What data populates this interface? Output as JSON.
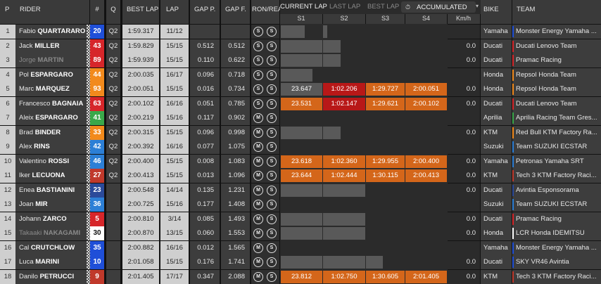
{
  "columns": {
    "pos": "P",
    "rider": "RIDER",
    "num": "#",
    "q": "Q",
    "best": "BEST LAP",
    "lap": "LAP",
    "gap_p": "GAP P.",
    "gap_f": "GAP F.",
    "tyres": "RON/REAR",
    "s1": "S1",
    "s2": "S2",
    "s3": "S3",
    "s4": "S4",
    "kmh": "Km/h",
    "bike": "BIKE",
    "team": "TEAM"
  },
  "tabs": {
    "current": "CURRENT LAP",
    "last": "LAST LAP",
    "best": "BEST LAP",
    "accumulated": "ACCUMULATED",
    "acc_icon": "stopwatch-icon",
    "chevron": "chevron-down-icon"
  },
  "colors": {
    "sector_orange": "#d4661a",
    "sector_red": "#b81818",
    "sector_grey": "#595959",
    "row_bg": "#3d3d3d",
    "light_cell": "#cfcfcf"
  },
  "rows": [
    {
      "pos": "1",
      "first": "Fabio",
      "last": "QUARTARARO",
      "num": "20",
      "num_color": "#1f4fd8",
      "q": "Q2",
      "best": "1:59.317",
      "lap": "11/12",
      "gap_p": "",
      "gap_f": "",
      "front": "S",
      "rear": "S",
      "s1": "",
      "s2": "",
      "s3": "",
      "s4": "",
      "s1_fill": 0.58,
      "s2_fill": 0.1,
      "s3_fill": 0,
      "s4_fill": 0,
      "sec_colors": [
        "",
        "",
        "",
        ""
      ],
      "kmh": "",
      "bike": "Yamaha",
      "team": "Monster Energy Yamaha ...",
      "team_color": "#1f4fd8",
      "dim": false
    },
    {
      "pos": "2",
      "first": "Jack",
      "last": "MILLER",
      "num": "43",
      "num_color": "#d6262a",
      "q": "Q2",
      "best": "1:59.829",
      "lap": "15/15",
      "gap_p": "0.512",
      "gap_f": "0.512",
      "front": "S",
      "rear": "S",
      "s1": "",
      "s2": "",
      "s3": "",
      "s4": "",
      "s1_fill": 1,
      "s2_fill": 0.42,
      "s3_fill": 0,
      "s4_fill": 0,
      "sec_colors": [
        "",
        "",
        "",
        ""
      ],
      "kmh": "0.0",
      "bike": "Ducati",
      "team": "Ducati Lenovo Team",
      "team_color": "#d6262a",
      "dim": false
    },
    {
      "pos": "3",
      "first": "Jorge",
      "last": "MARTIN",
      "num": "89",
      "num_color": "#d6262a",
      "q": "Q2",
      "best": "1:59.939",
      "lap": "15/15",
      "gap_p": "0.110",
      "gap_f": "0.622",
      "front": "S",
      "rear": "S",
      "s1": "",
      "s2": "",
      "s3": "",
      "s4": "",
      "s1_fill": 1,
      "s2_fill": 0.42,
      "s3_fill": 0,
      "s4_fill": 0,
      "sec_colors": [
        "",
        "",
        "",
        ""
      ],
      "kmh": "0.0",
      "bike": "Ducati",
      "team": "Pramac Racing",
      "team_color": "#d6262a",
      "dim": true
    },
    {
      "pos": "4",
      "first": "Pol",
      "last": "ESPARGARO",
      "num": "44",
      "num_color": "#f28a1c",
      "q": "Q2",
      "best": "2:00.035",
      "lap": "16/17",
      "gap_p": "0.096",
      "gap_f": "0.718",
      "front": "S",
      "rear": "S",
      "s1": "",
      "s2": "",
      "s3": "",
      "s4": "",
      "s1_fill": 0.77,
      "s2_fill": 0,
      "s3_fill": 0,
      "s4_fill": 0,
      "sec_colors": [
        "",
        "",
        "",
        ""
      ],
      "kmh": "",
      "bike": "Honda",
      "team": "Repsol Honda Team",
      "team_color": "#f28a1c",
      "dim": false
    },
    {
      "pos": "5",
      "first": "Marc",
      "last": "MARQUEZ",
      "num": "93",
      "num_color": "#f28a1c",
      "q": "Q2",
      "best": "2:00.051",
      "lap": "15/15",
      "gap_p": "0.016",
      "gap_f": "0.734",
      "front": "S",
      "rear": "S",
      "s1": "23.647",
      "s2": "1:02.206",
      "s3": "1:29.727",
      "s4": "2:00.051",
      "s1_fill": 1,
      "s2_fill": 1,
      "s3_fill": 1,
      "s4_fill": 1,
      "sec_colors": [
        "#595959",
        "#b81818",
        "#d4661a",
        "#d4661a"
      ],
      "kmh": "0.0",
      "bike": "Honda",
      "team": "Repsol Honda Team",
      "team_color": "#f28a1c",
      "dim": false
    },
    {
      "pos": "6",
      "first": "Francesco",
      "last": "BAGNAIA",
      "num": "63",
      "num_color": "#d6262a",
      "q": "Q2",
      "best": "2:00.102",
      "lap": "16/16",
      "gap_p": "0.051",
      "gap_f": "0.785",
      "front": "S",
      "rear": "S",
      "s1": "23.531",
      "s2": "1:02.147",
      "s3": "1:29.621",
      "s4": "2:00.102",
      "s1_fill": 1,
      "s2_fill": 1,
      "s3_fill": 1,
      "s4_fill": 1,
      "sec_colors": [
        "#d4661a",
        "#b81818",
        "#d4661a",
        "#d4661a"
      ],
      "kmh": "0.0",
      "bike": "Ducati",
      "team": "Ducati Lenovo Team",
      "team_color": "#d6262a",
      "dim": false
    },
    {
      "pos": "7",
      "first": "Aleix",
      "last": "ESPARGARO",
      "num": "41",
      "num_color": "#3aa84a",
      "q": "Q2",
      "best": "2:00.219",
      "lap": "15/16",
      "gap_p": "0.117",
      "gap_f": "0.902",
      "front": "M",
      "rear": "S",
      "s1": "",
      "s2": "",
      "s3": "",
      "s4": "",
      "s1_fill": 0,
      "s2_fill": 0,
      "s3_fill": 0,
      "s4_fill": 0,
      "sec_colors": [
        "",
        "",
        "",
        ""
      ],
      "kmh": "",
      "bike": "Aprilia",
      "team": "Aprilia Racing Team Gres...",
      "team_color": "#3aa84a",
      "dim": false
    },
    {
      "pos": "8",
      "first": "Brad",
      "last": "BINDER",
      "num": "33",
      "num_color": "#f28a1c",
      "q": "Q2",
      "best": "2:00.315",
      "lap": "15/15",
      "gap_p": "0.096",
      "gap_f": "0.998",
      "front": "M",
      "rear": "S",
      "s1": "",
      "s2": "",
      "s3": "",
      "s4": "",
      "s1_fill": 1,
      "s2_fill": 0.42,
      "s3_fill": 0,
      "s4_fill": 0,
      "sec_colors": [
        "",
        "",
        "",
        ""
      ],
      "kmh": "0.0",
      "bike": "KTM",
      "team": "Red Bull KTM Factory Ra...",
      "team_color": "#f28a1c",
      "dim": false
    },
    {
      "pos": "9",
      "first": "Alex",
      "last": "RINS",
      "num": "42",
      "num_color": "#2c7fd6",
      "q": "Q2",
      "best": "2:00.392",
      "lap": "16/16",
      "gap_p": "0.077",
      "gap_f": "1.075",
      "front": "M",
      "rear": "S",
      "s1": "",
      "s2": "",
      "s3": "",
      "s4": "",
      "s1_fill": 0,
      "s2_fill": 0,
      "s3_fill": 0,
      "s4_fill": 0,
      "sec_colors": [
        "",
        "",
        "",
        ""
      ],
      "kmh": "",
      "bike": "Suzuki",
      "team": "Team SUZUKI ECSTAR",
      "team_color": "#2c7fd6",
      "dim": false
    },
    {
      "pos": "10",
      "first": "Valentino",
      "last": "ROSSI",
      "num": "46",
      "num_color": "#2c7fd6",
      "q": "Q2",
      "best": "2:00.400",
      "lap": "15/15",
      "gap_p": "0.008",
      "gap_f": "1.083",
      "front": "M",
      "rear": "S",
      "s1": "23.618",
      "s2": "1:02.360",
      "s3": "1:29.955",
      "s4": "2:00.400",
      "s1_fill": 1,
      "s2_fill": 1,
      "s3_fill": 1,
      "s4_fill": 1,
      "sec_colors": [
        "#d4661a",
        "#d4661a",
        "#d4661a",
        "#d4661a"
      ],
      "kmh": "0.0",
      "bike": "Yamaha",
      "team": "Petronas Yamaha SRT",
      "team_color": "#2c7fd6",
      "dim": false
    },
    {
      "pos": "11",
      "first": "Iker",
      "last": "LECUONA",
      "num": "27",
      "num_color": "#c0392b",
      "q": "Q2",
      "best": "2:00.413",
      "lap": "15/15",
      "gap_p": "0.013",
      "gap_f": "1.096",
      "front": "M",
      "rear": "S",
      "s1": "23.644",
      "s2": "1:02.444",
      "s3": "1:30.115",
      "s4": "2:00.413",
      "s1_fill": 1,
      "s2_fill": 1,
      "s3_fill": 1,
      "s4_fill": 1,
      "sec_colors": [
        "#d4661a",
        "#d4661a",
        "#d4661a",
        "#d4661a"
      ],
      "kmh": "0.0",
      "bike": "KTM",
      "team": "Tech 3 KTM Factory Raci...",
      "team_color": "#c0392b",
      "dim": false
    },
    {
      "pos": "12",
      "first": "Enea",
      "last": "BASTIANINI",
      "num": "23",
      "num_color": "#2b4a9a",
      "q": "",
      "best": "2:00.548",
      "lap": "14/14",
      "gap_p": "0.135",
      "gap_f": "1.231",
      "front": "M",
      "rear": "S",
      "s1": "",
      "s2": "",
      "s3": "",
      "s4": "",
      "s1_fill": 1,
      "s2_fill": 1,
      "s3_fill": 0,
      "s4_fill": 0,
      "sec_colors": [
        "",
        "",
        "",
        ""
      ],
      "kmh": "0.0",
      "bike": "Ducati",
      "team": "Avintia Esponsorama",
      "team_color": "#2b4a9a",
      "dim": false
    },
    {
      "pos": "13",
      "first": "Joan",
      "last": "MIR",
      "num": "36",
      "num_color": "#2c7fd6",
      "q": "",
      "best": "2:00.725",
      "lap": "15/16",
      "gap_p": "0.177",
      "gap_f": "1.408",
      "front": "M",
      "rear": "S",
      "s1": "",
      "s2": "",
      "s3": "",
      "s4": "",
      "s1_fill": 0,
      "s2_fill": 0,
      "s3_fill": 0,
      "s4_fill": 0,
      "sec_colors": [
        "",
        "",
        "",
        ""
      ],
      "kmh": "",
      "bike": "Suzuki",
      "team": "Team SUZUKI ECSTAR",
      "team_color": "#2c7fd6",
      "dim": false
    },
    {
      "pos": "14",
      "first": "Johann",
      "last": "ZARCO",
      "num": "5",
      "num_color": "#d6262a",
      "q": "",
      "best": "2:00.810",
      "lap": "3/14",
      "gap_p": "0.085",
      "gap_f": "1.493",
      "front": "M",
      "rear": "S",
      "s1": "",
      "s2": "",
      "s3": "",
      "s4": "",
      "s1_fill": 1,
      "s2_fill": 1,
      "s3_fill": 0,
      "s4_fill": 0,
      "sec_colors": [
        "",
        "",
        "",
        ""
      ],
      "kmh": "0.0",
      "bike": "Ducati",
      "team": "Pramac Racing",
      "team_color": "#d6262a",
      "dim": false
    },
    {
      "pos": "15",
      "first": "Takaaki",
      "last": "NAKAGAMI",
      "num": "30",
      "num_color": "#ffffff",
      "q": "",
      "best": "2:00.870",
      "lap": "13/15",
      "gap_p": "0.060",
      "gap_f": "1.553",
      "front": "M",
      "rear": "S",
      "s1": "",
      "s2": "",
      "s3": "",
      "s4": "",
      "s1_fill": 1,
      "s2_fill": 1,
      "s3_fill": 0,
      "s4_fill": 0,
      "sec_colors": [
        "",
        "",
        "",
        ""
      ],
      "kmh": "0.0",
      "bike": "Honda",
      "team": "LCR Honda IDEMITSU",
      "team_color": "#ffffff",
      "dim": true
    },
    {
      "pos": "16",
      "first": "Cal",
      "last": "CRUTCHLOW",
      "num": "35",
      "num_color": "#1f4fd8",
      "q": "",
      "best": "2:00.882",
      "lap": "16/16",
      "gap_p": "0.012",
      "gap_f": "1.565",
      "front": "M",
      "rear": "S",
      "s1": "",
      "s2": "",
      "s3": "",
      "s4": "",
      "s1_fill": 0,
      "s2_fill": 0,
      "s3_fill": 0,
      "s4_fill": 0,
      "sec_colors": [
        "",
        "",
        "",
        ""
      ],
      "kmh": "",
      "bike": "Yamaha",
      "team": "Monster Energy Yamaha ...",
      "team_color": "#1f4fd8",
      "dim": false
    },
    {
      "pos": "17",
      "first": "Luca",
      "last": "MARINI",
      "num": "10",
      "num_color": "#1f4fd8",
      "q": "",
      "best": "2:01.058",
      "lap": "15/15",
      "gap_p": "0.176",
      "gap_f": "1.741",
      "front": "M",
      "rear": "S",
      "s1": "",
      "s2": "",
      "s3": "",
      "s4": "",
      "s1_fill": 1,
      "s2_fill": 1,
      "s3_fill": 0.43,
      "s4_fill": 0,
      "sec_colors": [
        "",
        "",
        "",
        ""
      ],
      "kmh": "0.0",
      "bike": "Ducati",
      "team": "SKY VR46 Avintia",
      "team_color": "#1f4fd8",
      "dim": false
    },
    {
      "pos": "18",
      "first": "Danilo",
      "last": "PETRUCCI",
      "num": "9",
      "num_color": "#c0392b",
      "q": "",
      "best": "2:01.405",
      "lap": "17/17",
      "gap_p": "0.347",
      "gap_f": "2.088",
      "front": "M",
      "rear": "S",
      "s1": "23.812",
      "s2": "1:02.750",
      "s3": "1:30.605",
      "s4": "2:01.405",
      "s1_fill": 1,
      "s2_fill": 1,
      "s3_fill": 1,
      "s4_fill": 1,
      "sec_colors": [
        "#d4661a",
        "#d4661a",
        "#d4661a",
        "#d4661a"
      ],
      "kmh": "0.0",
      "bike": "KTM",
      "team": "Tech 3 KTM Factory Raci...",
      "team_color": "#c0392b",
      "dim": false
    }
  ]
}
